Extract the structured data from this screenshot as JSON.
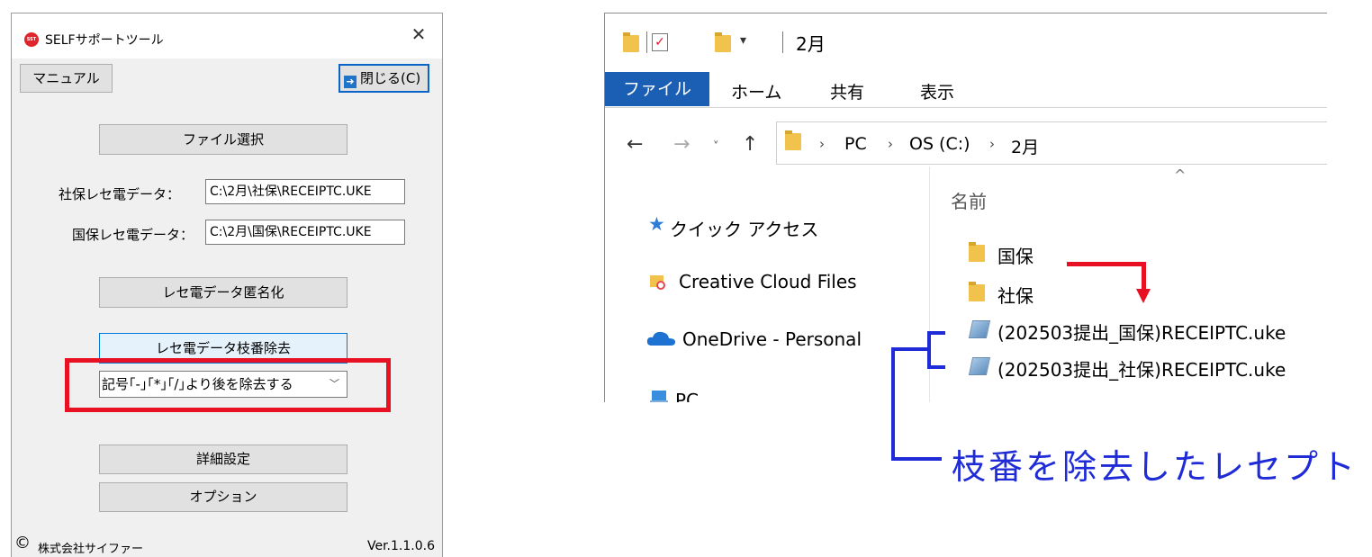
{
  "dialog": {
    "title": "SELFサポートツール",
    "logo_text": "SST",
    "close_glyph": "✕",
    "manual_button": "マニュアル",
    "close_button": "閉じる(C)",
    "file_select_button": "ファイル選択",
    "shaho_label": "社保レセ電データ：",
    "shaho_value": "C:\\2月\\社保\\RECEIPTC.UKE",
    "kokuho_label": "国保レセ電データ：",
    "kokuho_value": "C:\\2月\\国保\\RECEIPTC.UKE",
    "anonymize_button": "レセ電データ匿名化",
    "branch_remove_button": "レセ電データ枝番除去",
    "branch_option_selected": "記号｢-｣｢*｣｢/｣より後を除去する",
    "detail_button": "詳細設定",
    "option_button": "オプション",
    "copyright_symbol": "©",
    "company": "株式会社サイファー",
    "version": "Ver.1.1.0.6",
    "highlight_color": "#e81123"
  },
  "explorer": {
    "title": "2月",
    "ribbon": {
      "file_tab": "ファイル",
      "tabs": [
        "ホーム",
        "共有",
        "表示"
      ]
    },
    "breadcrumb": [
      "PC",
      "OS (C:)",
      "2月"
    ],
    "column_header": "名前",
    "nav_pane": [
      "クイック アクセス",
      "Creative Cloud Files",
      "OneDrive - Personal",
      "PC"
    ],
    "files": [
      {
        "name": "国保",
        "type": "folder"
      },
      {
        "name": "社保",
        "type": "folder"
      },
      {
        "name": "(202503提出_国保)RECEIPTC.uke",
        "type": "uke"
      },
      {
        "name": "(202503提出_社保)RECEIPTC.uke",
        "type": "uke"
      }
    ],
    "accent_color": "#1a5fb4"
  },
  "annotation": {
    "label": "枝番を除去したレセプト",
    "color": "#1f2bd6"
  }
}
